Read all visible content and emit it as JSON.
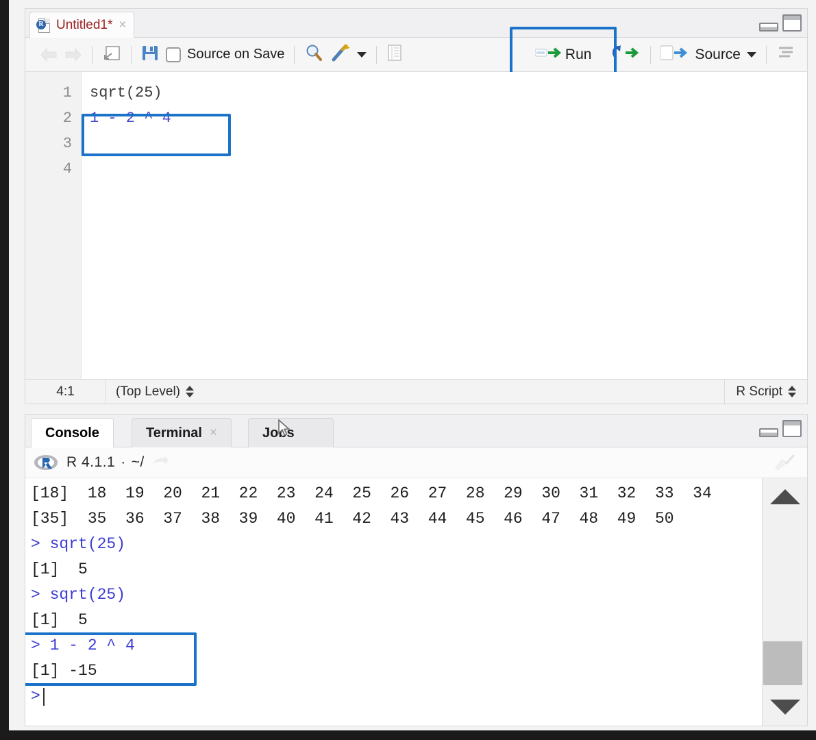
{
  "source_pane": {
    "tab": {
      "title": "Untitled1*",
      "close_label": "×",
      "icon": "r-script-file-icon",
      "badge": "R"
    },
    "window_controls": {
      "minimize": "minimize-icon",
      "maximize": "maximize-icon"
    },
    "toolbar": {
      "back_icon": "back-arrow-icon",
      "forward_icon": "forward-arrow-icon",
      "popout_icon": "show-in-new-window-icon",
      "save_icon": "save-icon",
      "source_on_save_label": "Source on Save",
      "find_icon": "find-replace-icon",
      "magic_icon": "code-tools-icon",
      "magic_caret": "chevron-down-icon",
      "compile_report_icon": "compile-report-icon",
      "run_label": "Run",
      "run_icon": "run-line-icon",
      "rerun_icon": "re-run-icon",
      "source_label": "Source",
      "source_icon": "source-icon",
      "source_caret": "chevron-down-icon",
      "outline_icon": "document-outline-icon"
    },
    "editor": {
      "gutter": [
        "1",
        "2",
        "3",
        "4"
      ],
      "lines": [
        {
          "text": "sqrt(25)",
          "highlighted": false
        },
        {
          "text": "",
          "highlighted": false
        },
        {
          "text": "1 - 2 ^ 4",
          "highlighted": true
        },
        {
          "text": "",
          "highlighted": false
        }
      ]
    },
    "status_bar": {
      "cursor_position": "4:1",
      "scope": "(Top Level)",
      "scope_stepper": "up-down-stepper-icon",
      "file_type": "R Script",
      "file_type_stepper": "up-down-stepper-icon"
    }
  },
  "console_pane": {
    "tabs": [
      {
        "label": "Console",
        "active": true,
        "closable": false
      },
      {
        "label": "Terminal",
        "active": false,
        "closable": true,
        "close_label": "×"
      },
      {
        "label": "Jobs",
        "active": false,
        "closable": false
      }
    ],
    "window_controls": {
      "minimize": "minimize-icon",
      "maximize": "maximize-icon"
    },
    "header": {
      "logo": "r-logo-icon",
      "version": "R 4.1.1",
      "separator": "·",
      "working_dir": "~/",
      "dir_arrow_icon": "open-directory-icon",
      "clear_console_icon": "broom-clear-icon"
    },
    "output": [
      {
        "text": "[18]  18  19  20  21  22  23  24  25  26  27  28  29  30  31  32  33  34",
        "kind": "result",
        "highlighted": false
      },
      {
        "text": "[35]  35  36  37  38  39  40  41  42  43  44  45  46  47  48  49  50",
        "kind": "result",
        "highlighted": false
      },
      {
        "text": "> sqrt(25)",
        "kind": "command",
        "highlighted": false
      },
      {
        "text": "[1]  5",
        "kind": "result",
        "highlighted": false
      },
      {
        "text": "> sqrt(25)",
        "kind": "command",
        "highlighted": false
      },
      {
        "text": "[1]  5",
        "kind": "result",
        "highlighted": false
      },
      {
        "text": "> 1 - 2 ^ 4",
        "kind": "command",
        "highlighted": true
      },
      {
        "text": "[1] -15",
        "kind": "result",
        "highlighted": true
      },
      {
        "text": ">",
        "kind": "prompt",
        "highlighted": false
      }
    ],
    "scrollbar": {
      "up_icon": "scroll-up-arrow-icon",
      "down_icon": "scroll-down-arrow-icon",
      "thumb": "scrollbar-thumb"
    }
  },
  "annotations": {
    "highlight_color": "#1a73c8",
    "boxes": [
      "run-button-highlight",
      "editor-line-3-highlight",
      "console-result-highlight"
    ]
  },
  "mouse_cursor": "pointer-arrow-cursor"
}
